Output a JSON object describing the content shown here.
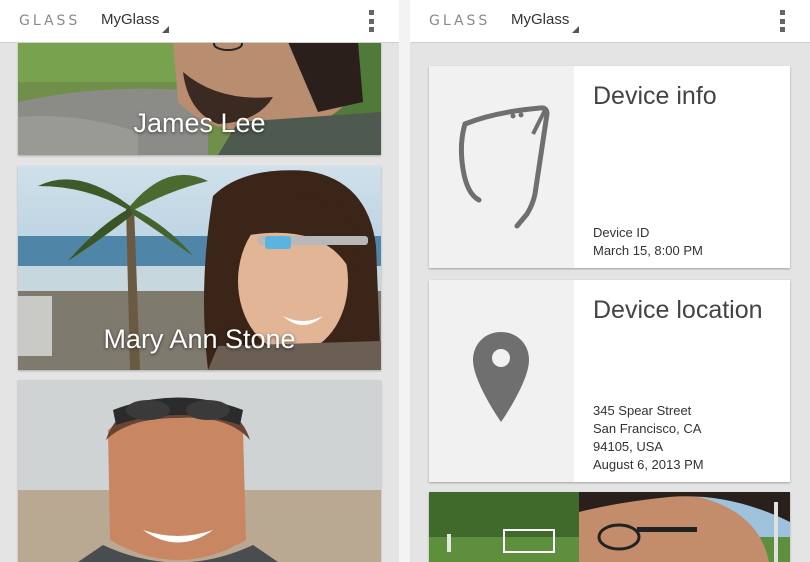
{
  "left_screen": {
    "appbar": {
      "brand": "GLASS",
      "title": "MyGlass"
    },
    "contacts": [
      {
        "name": "James Lee"
      },
      {
        "name": "Mary Ann Stone"
      },
      {
        "name": ""
      }
    ]
  },
  "right_screen": {
    "appbar": {
      "brand": "GLASS",
      "title": "MyGlass"
    },
    "device_info": {
      "title": "Device info",
      "lines": [
        "Device ID",
        "March 15, 8:00 PM"
      ]
    },
    "device_location": {
      "title": "Device location",
      "lines": [
        "345 Spear Street",
        "San Francisco, CA",
        "94105, USA",
        "August 6, 2013 PM"
      ]
    }
  },
  "colors": {
    "appbar_bg": "#ffffff",
    "background": "#e4e4e4",
    "icon_gray": "#6f6f6f",
    "glass_accent": "#5ab4e0"
  },
  "icons": {
    "overflow": "overflow-menu-icon",
    "glass": "glass-device-icon",
    "location": "location-pin-icon"
  }
}
